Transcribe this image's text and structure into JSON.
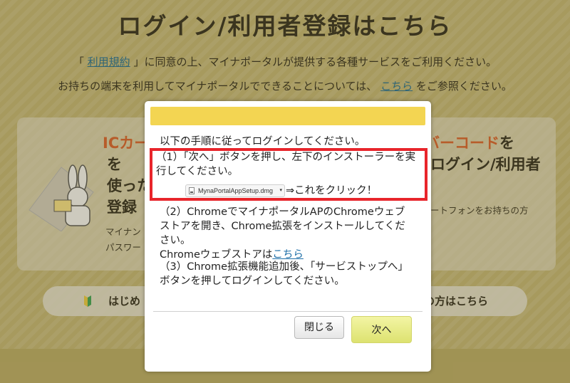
{
  "page": {
    "title": "ログイン/利用者登録はこちら",
    "terms_prefix": "「",
    "terms_link": "利用規約",
    "terms_suffix": "」に同意の上、マイナポータルが提供する各種サービスをご利用ください。",
    "devices_prefix": "お持ちの端末を利用してマイナポータルでできることについては、",
    "devices_link": "こちら",
    "devices_suffix": "をご参照ください。"
  },
  "left_card": {
    "heading_accent": "ICカー",
    "line2": "を",
    "line3": "使っ",
    "line3b": "た",
    "line4": "登録",
    "small1": "マイナン",
    "small2": "パスワー"
  },
  "right_card": {
    "heading_accent": "バーコード",
    "heading_suffix": "を",
    "line2": "ログイン/利用者",
    "small": "ートフォンをお持ちの方"
  },
  "buttons_bg": {
    "left_label": "はじめ",
    "right_label": "の方はこちら"
  },
  "modal": {
    "intro": "以下の手順に従ってログインしてください。",
    "step1": "（1）「次へ」ボタンを押し、左下のインストーラーを実行してください。",
    "download_filename": "MynaPortalAppSetup.dmg",
    "download_caret": "▾",
    "click_hint": "⇒これをクリック！",
    "step2": "（2）ChromeでマイナポータルAPのChromeウェブストアを開き、Chrome拡張をインストールしてください。",
    "step2_link_prefix": "Chromeウェブストアは",
    "step2_link": "こちら",
    "step3": "（3）Chrome拡張機能追加後、「サービストップへ」ボタンを押してログインしてください。",
    "close_label": "閉じる",
    "next_label": "次へ"
  },
  "colors": {
    "background": "#c9bb76",
    "header_bar": "#f3d552",
    "highlight_border": "#e8252b",
    "accent": "#e0622b",
    "link": "#1e6fa8"
  }
}
